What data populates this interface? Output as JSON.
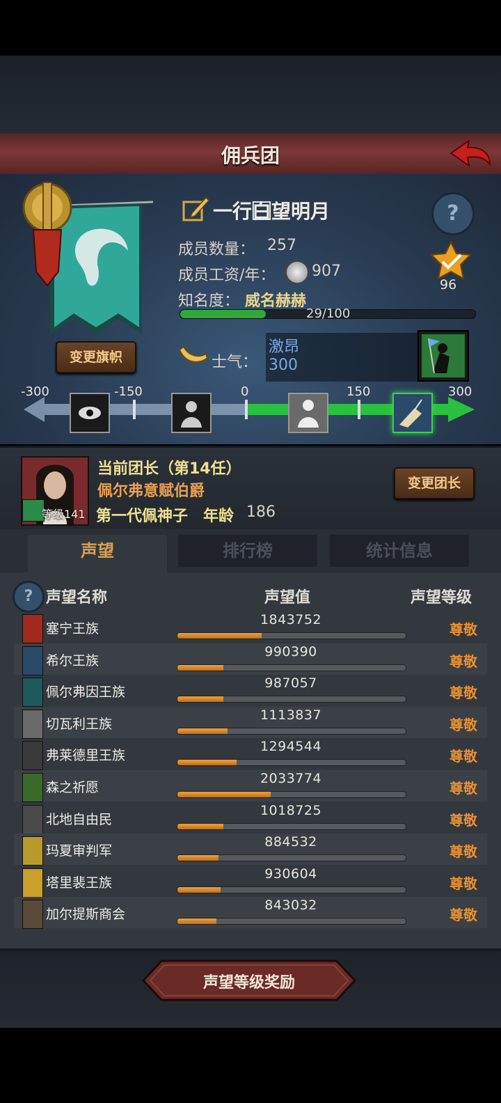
{
  "header": {
    "title": "佣兵团",
    "back_icon": "back-arrow-icon"
  },
  "guild": {
    "name": "一行白⃞望明月",
    "member_count_label": "成员数量：",
    "member_count": "257",
    "salary_label": "成员工资/年：",
    "salary": "907",
    "fame_label": "知名度：",
    "fame_value": "威名赫赫",
    "fame_progress_text": "29/100",
    "fame_progress": 0.29,
    "change_banner_label": "变更旗帜",
    "rank_badge": "96",
    "morale_label": "士气：",
    "morale_state": "激昂",
    "morale_value": "300"
  },
  "morale_scale": {
    "ticks": [
      "-300",
      "-150",
      "0",
      "150",
      "300"
    ],
    "current": 300,
    "min": -300,
    "max": 300
  },
  "leader": {
    "title": "当前团长（第14任）",
    "name": "佩尔弗意赋伯爵",
    "level_label": "等级141",
    "lineage": "第一代佩神子",
    "age_label": "年龄",
    "age": "186",
    "change_leader_label": "变更团长"
  },
  "tabs": [
    {
      "label": "声望",
      "active": true
    },
    {
      "label": "排行榜",
      "active": false
    },
    {
      "label": "统计信息",
      "active": false
    }
  ],
  "table": {
    "col_name": "声望名称",
    "col_value": "声望值",
    "col_level": "声望等级",
    "rows": [
      {
        "name": "塞宁王族",
        "value": "1843752",
        "fill": 0.37,
        "level": "尊敬",
        "color": "#a02a1e"
      },
      {
        "name": "希尔王族",
        "value": "990390",
        "fill": 0.2,
        "level": "尊敬",
        "color": "#2a4a6a"
      },
      {
        "name": "佩尔弗因王族",
        "value": "987057",
        "fill": 0.2,
        "level": "尊敬",
        "color": "#1e5a5a"
      },
      {
        "name": "切瓦利王族",
        "value": "1113837",
        "fill": 0.22,
        "level": "尊敬",
        "color": "#6a6a6a"
      },
      {
        "name": "弗莱德里王族",
        "value": "1294544",
        "fill": 0.26,
        "level": "尊敬",
        "color": "#3a3a3a"
      },
      {
        "name": "森之祈愿",
        "value": "2033774",
        "fill": 0.41,
        "level": "尊敬",
        "color": "#3a6a2a"
      },
      {
        "name": "北地自由民",
        "value": "1018725",
        "fill": 0.2,
        "level": "尊敬",
        "color": "#4a4a4a"
      },
      {
        "name": "玛夏审判军",
        "value": "884532",
        "fill": 0.18,
        "level": "尊敬",
        "color": "#b89a2a"
      },
      {
        "name": "塔里裴王族",
        "value": "930604",
        "fill": 0.19,
        "level": "尊敬",
        "color": "#c8a02a"
      },
      {
        "name": "加尔提斯商会",
        "value": "843032",
        "fill": 0.17,
        "level": "尊敬",
        "color": "#5a4a3a"
      }
    ]
  },
  "footer": {
    "reward_label": "声望等级奖励"
  }
}
